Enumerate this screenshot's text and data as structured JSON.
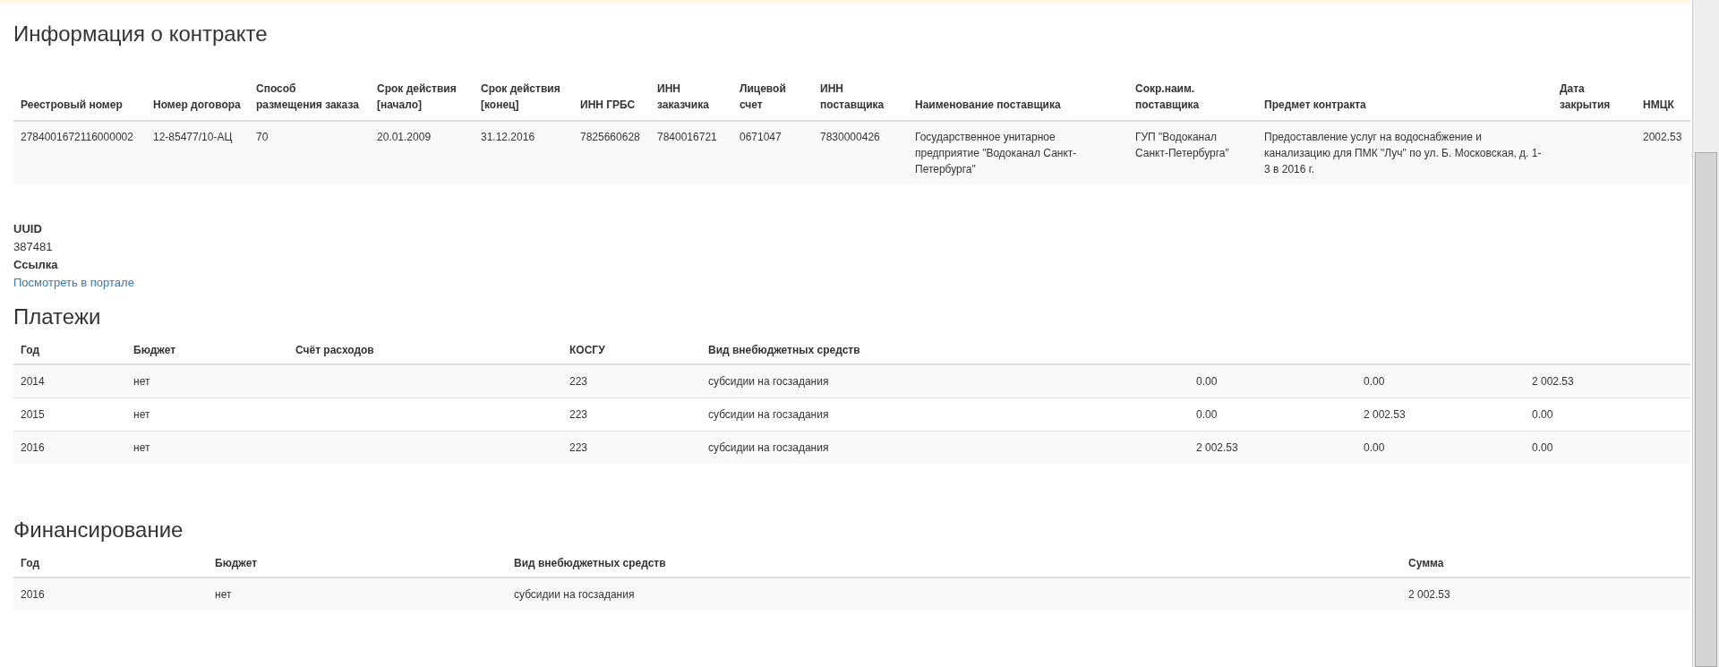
{
  "contract": {
    "title": "Информация о контракте",
    "columns": [
      "Реестровый номер",
      "Номер договора",
      "Способ размещения заказа",
      "Срок действия [начало]",
      "Срок действия [конец]",
      "ИНН ГРБС",
      "ИНН заказчика",
      "Лицевой счет",
      "ИНН поставщика",
      "Наименование поставщика",
      "Сокр.наим. поставщика",
      "Предмет контракта",
      "Дата закрытия",
      "НМЦК"
    ],
    "rows": [
      {
        "cells": [
          "2784001672116000002",
          "12-85477/10-АЦ",
          "70",
          "20.01.2009",
          "31.12.2016",
          "7825660628",
          "7840016721",
          "0671047",
          "7830000426",
          "Государственное унитарное предприятие \"Водоканал Санкт-Петербурга\"",
          "ГУП \"Водоканал Санкт-Петербурга\"",
          "Предоставление услуг на водоснабжение и канализацию для ПМК \"Луч\" по ул. Б. Московская, д. 1-3 в 2016 г.",
          "",
          "2002.53"
        ]
      }
    ]
  },
  "details": [
    {
      "label": "UUID",
      "value": "387481",
      "kind": "text"
    },
    {
      "label": "Ссылка",
      "value": "Посмотреть в портале",
      "kind": "link"
    }
  ],
  "payments": {
    "title": "Платежи",
    "columns": [
      "Год",
      "Бюджет",
      "Счёт расходов",
      "КОСГУ",
      "Вид внебюджетных средств"
    ],
    "rows": [
      {
        "cells": [
          "2014",
          "нет",
          "",
          "223",
          "субсидии на госзадания",
          "0.00",
          "0.00",
          "2 002.53"
        ]
      },
      {
        "cells": [
          "2015",
          "нет",
          "",
          "223",
          "субсидии на госзадания",
          "0.00",
          "2 002.53",
          "0.00"
        ]
      },
      {
        "cells": [
          "2016",
          "нет",
          "",
          "223",
          "субсидии на госзадания",
          "2 002.53",
          "0.00",
          "0.00"
        ]
      }
    ]
  },
  "financing": {
    "title": "Финансирование",
    "columns": [
      "Год",
      "Бюджет",
      "Вид внебюджетных средств",
      "Сумма"
    ],
    "rows": [
      {
        "cells": [
          "2016",
          "нет",
          "субсидии на госзадания",
          "2 002.53"
        ]
      }
    ]
  }
}
